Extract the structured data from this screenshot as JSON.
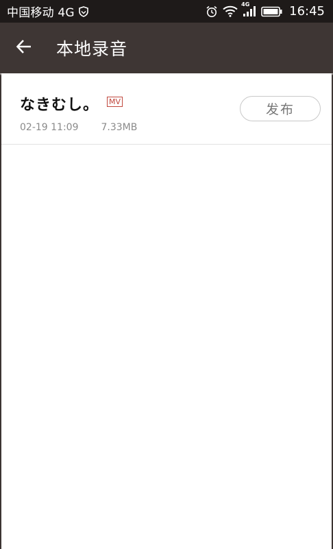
{
  "status_bar": {
    "carrier": "中国移动 4G",
    "network_badge": "4G",
    "time": "16:45",
    "icons": [
      "shield-icon",
      "alarm-icon",
      "wifi-icon",
      "signal-icon",
      "battery-icon"
    ]
  },
  "header": {
    "title": "本地录音",
    "back_icon": "back-arrow-icon"
  },
  "recordings": [
    {
      "title": "なきむし。",
      "badge": "MV",
      "date": "02-19 11:09",
      "size": "7.33MB",
      "action_label": "发布"
    }
  ],
  "colors": {
    "status_bar_bg": "#1e1a19",
    "app_bar_bg": "#3e3634",
    "mv_badge": "#c0463c",
    "meta_text": "#8a8a8a"
  }
}
